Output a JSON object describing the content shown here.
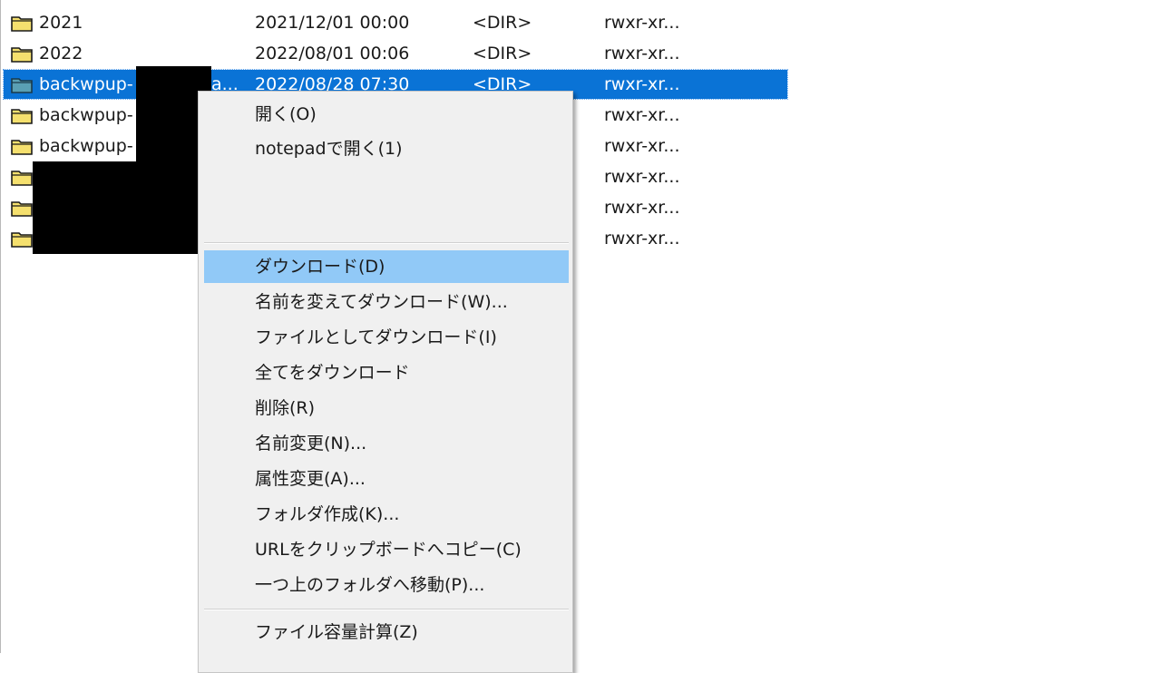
{
  "file_list": {
    "rows": [
      {
        "name": "2021",
        "date": "2021/12/01 00:00",
        "size": "<DIR>",
        "perm": "rwxr-xr..."
      },
      {
        "name": "2022",
        "date": "2022/08/01 00:06",
        "size": "<DIR>",
        "perm": "rwxr-xr..."
      },
      {
        "name": "backwpup-",
        "name_tail": "a...",
        "date": "2022/08/28 07:30",
        "size": "<DIR>",
        "perm": "rwxr-xr..."
      },
      {
        "name": "backwpup-",
        "perm": "rwxr-xr..."
      },
      {
        "name": "backwpup-",
        "perm": "rwxr-xr..."
      },
      {
        "perm": "rwxr-xr..."
      },
      {
        "perm": "rwxr-xr..."
      },
      {
        "perm": "rwxr-xr..."
      }
    ],
    "selected_index": 2,
    "colors": {
      "selection": "#0a73d6",
      "folder": "#f5e06e",
      "folder_selected": "#5aa0b4"
    }
  },
  "context_menu": {
    "items": [
      {
        "label": "開く(O)"
      },
      {
        "label": "notepadで開く(1)"
      },
      {
        "label": "ダウンロード(D)"
      },
      {
        "label": "名前を変えてダウンロード(W)..."
      },
      {
        "label": "ファイルとしてダウンロード(I)"
      },
      {
        "label": "全てをダウンロード"
      },
      {
        "label": "削除(R)"
      },
      {
        "label": "名前変更(N)..."
      },
      {
        "label": "属性変更(A)..."
      },
      {
        "label": "フォルダ作成(K)..."
      },
      {
        "label": "URLをクリップボードへコピー(C)"
      },
      {
        "label": "一つ上のフォルダへ移動(P)..."
      },
      {
        "label": "ファイル容量計算(Z)"
      }
    ],
    "highlighted_index": 2,
    "colors": {
      "background": "#f0f0f0",
      "highlight": "#91c9f7"
    }
  }
}
